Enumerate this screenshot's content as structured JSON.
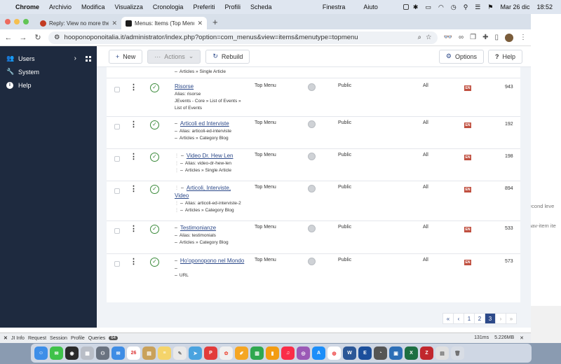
{
  "macbar": {
    "app": "Chrome",
    "menus": [
      "Archivio",
      "Modifica",
      "Visualizza",
      "Cronologia",
      "Preferiti",
      "Profili",
      "Scheda"
    ],
    "right_menus": [
      "Finestra",
      "Aiuto"
    ],
    "date": "Mar 26 dic",
    "time": "18:52"
  },
  "tabs": [
    {
      "title": "Reply: View no more then 3 ite",
      "favicon_color": "#c23b22"
    },
    {
      "title": "Menus: Items (Top Menu) - Ho",
      "favicon_color": "#1c1c1c"
    }
  ],
  "url": "hooponoponoitalia.it/administrator/index.php?option=com_menus&view=items&menutype=topmenu",
  "sidebar": [
    {
      "label": "Users",
      "icon": "users-icon"
    },
    {
      "label": "System",
      "icon": "wrench-icon"
    },
    {
      "label": "Help",
      "icon": "info-icon"
    }
  ],
  "toolbar": {
    "new": "New",
    "actions": "Actions",
    "rebuild": "Rebuild",
    "options": "Options",
    "help": "Help"
  },
  "prev_row": {
    "path": "Articles » Single Article"
  },
  "rows": [
    {
      "title": "Risorse",
      "alias": "Alias: risorse",
      "type_line1": "JEvents - Core » List of Events »",
      "type_line2": "List of Events",
      "menu": "Top Menu",
      "access": "Public",
      "lang": "All",
      "id": "943"
    },
    {
      "title": "Articoli ed Interviste",
      "alias": "Alias: articoli-ed-interviste",
      "type": "Articles » Category Blog",
      "menu": "Top Menu",
      "access": "Public",
      "lang": "All",
      "id": "192"
    },
    {
      "title": "Video Dr. Hew Len",
      "alias": "Alias: video-dr-hew-len",
      "type": "Articles » Single Article",
      "menu": "Top Menu",
      "access": "Public",
      "lang": "All",
      "id": "198"
    },
    {
      "title_line1": "Articoli, Interviste,",
      "title_line2": "Video",
      "alias": "Alias: articoli-ed-interviste-2",
      "type": "Articles » Category Blog",
      "menu": "Top Menu",
      "access": "Public",
      "lang": "All",
      "id": "894"
    },
    {
      "title": "Testimonianze",
      "alias": "Alias: testimonials",
      "type": "Articles » Category Blog",
      "menu": "Top Menu",
      "access": "Public",
      "lang": "All",
      "id": "533"
    },
    {
      "title": "Ho'oponopono nel Mondo",
      "type": "URL",
      "menu": "Top Menu",
      "access": "Public",
      "lang": "All",
      "id": "573"
    }
  ],
  "flag_text": "EN",
  "pagination": {
    "first": "«",
    "prev": "‹",
    "pages": [
      "1",
      "2",
      "3"
    ],
    "current": "3",
    "next": "›",
    "last": "»"
  },
  "debug": {
    "items": [
      "JI Info",
      "Request",
      "Session",
      "Profile",
      "Queries"
    ],
    "queries": "64",
    "time": "131ms",
    "memory": "5.226MB"
  },
  "bg_text": {
    "t1": "econd leve",
    "t2": "nav-item ite"
  },
  "dock_date": "26"
}
